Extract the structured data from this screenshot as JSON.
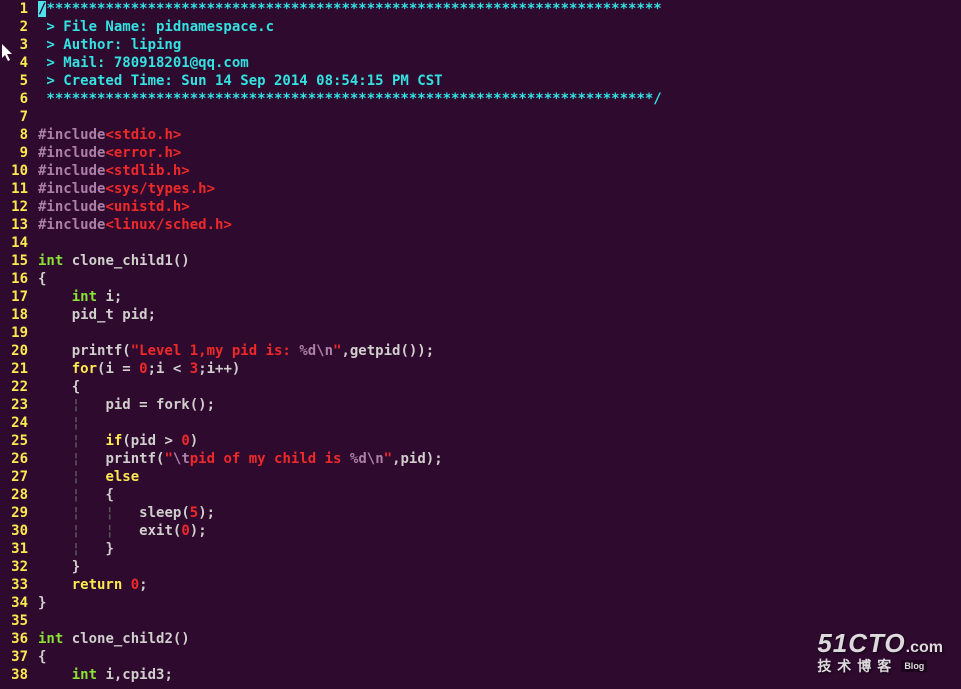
{
  "file": {
    "name": "pidnamespace.c",
    "author": "liping",
    "email": "780918201@qq.com",
    "created": "Sun 14 Sep 2014 08:54:15 PM CST"
  },
  "watermark": {
    "site_main": "51CTO",
    "site_domain": ".com",
    "subtitle": "技术博客",
    "badge": "Blog"
  },
  "lines": [
    {
      "n": 1,
      "segs": [
        {
          "cls": "cursor-cell",
          "t": "/"
        },
        {
          "cls": "c-comment",
          "t": "*************************************************************************"
        }
      ]
    },
    {
      "n": 2,
      "segs": [
        {
          "cls": "c-comment",
          "t": " > File Name: pidnamespace.c"
        }
      ]
    },
    {
      "n": 3,
      "segs": [
        {
          "cls": "c-comment",
          "t": " > Author: liping"
        }
      ]
    },
    {
      "n": 4,
      "segs": [
        {
          "cls": "c-comment",
          "t": " > Mail: 780918201@qq.com"
        }
      ]
    },
    {
      "n": 5,
      "segs": [
        {
          "cls": "c-comment",
          "t": " > Created Time: Sun 14 Sep 2014 08:54:15 PM CST"
        }
      ]
    },
    {
      "n": 6,
      "segs": [
        {
          "cls": "c-comment",
          "t": " ************************************************************************/"
        }
      ]
    },
    {
      "n": 7,
      "segs": [
        {
          "cls": "",
          "t": ""
        }
      ]
    },
    {
      "n": 8,
      "segs": [
        {
          "cls": "c-pp",
          "t": "#include"
        },
        {
          "cls": "c-hdr",
          "t": "<stdio.h>"
        }
      ]
    },
    {
      "n": 9,
      "segs": [
        {
          "cls": "c-pp",
          "t": "#include"
        },
        {
          "cls": "c-hdr",
          "t": "<error.h>"
        }
      ]
    },
    {
      "n": 10,
      "segs": [
        {
          "cls": "c-pp",
          "t": "#include"
        },
        {
          "cls": "c-hdr",
          "t": "<stdlib.h>"
        }
      ]
    },
    {
      "n": 11,
      "segs": [
        {
          "cls": "c-pp",
          "t": "#include"
        },
        {
          "cls": "c-hdr",
          "t": "<sys/types.h>"
        }
      ]
    },
    {
      "n": 12,
      "segs": [
        {
          "cls": "c-pp",
          "t": "#include"
        },
        {
          "cls": "c-hdr",
          "t": "<unistd.h>"
        }
      ]
    },
    {
      "n": 13,
      "segs": [
        {
          "cls": "c-pp",
          "t": "#include"
        },
        {
          "cls": "c-hdr",
          "t": "<linux/sched.h>"
        }
      ]
    },
    {
      "n": 14,
      "segs": [
        {
          "cls": "",
          "t": ""
        }
      ]
    },
    {
      "n": 15,
      "segs": [
        {
          "cls": "c-type",
          "t": "int"
        },
        {
          "cls": "",
          "t": " clone_child1()"
        }
      ]
    },
    {
      "n": 16,
      "segs": [
        {
          "cls": "",
          "t": "{"
        }
      ]
    },
    {
      "n": 17,
      "segs": [
        {
          "cls": "",
          "t": "    "
        },
        {
          "cls": "c-type",
          "t": "int"
        },
        {
          "cls": "",
          "t": " i;"
        }
      ]
    },
    {
      "n": 18,
      "segs": [
        {
          "cls": "",
          "t": "    pid_t pid;"
        }
      ]
    },
    {
      "n": 19,
      "segs": [
        {
          "cls": "",
          "t": ""
        }
      ]
    },
    {
      "n": 20,
      "segs": [
        {
          "cls": "",
          "t": "    printf("
        },
        {
          "cls": "c-str",
          "t": "\"Level 1,my pid is: "
        },
        {
          "cls": "c-fmt",
          "t": "%d\\n"
        },
        {
          "cls": "c-str",
          "t": "\""
        },
        {
          "cls": "",
          "t": ",getpid());"
        }
      ]
    },
    {
      "n": 21,
      "segs": [
        {
          "cls": "",
          "t": "    "
        },
        {
          "cls": "c-kw",
          "t": "for"
        },
        {
          "cls": "",
          "t": "(i = "
        },
        {
          "cls": "c-num",
          "t": "0"
        },
        {
          "cls": "",
          "t": ";i < "
        },
        {
          "cls": "c-num",
          "t": "3"
        },
        {
          "cls": "",
          "t": ";i++)"
        }
      ]
    },
    {
      "n": 22,
      "segs": [
        {
          "cls": "",
          "t": "    {"
        }
      ]
    },
    {
      "n": 23,
      "segs": [
        {
          "cls": "",
          "t": "    "
        },
        {
          "cls": "c-guide",
          "t": "¦"
        },
        {
          "cls": "",
          "t": "   pid = fork();"
        }
      ]
    },
    {
      "n": 24,
      "segs": [
        {
          "cls": "",
          "t": "    "
        },
        {
          "cls": "c-guide",
          "t": "¦"
        },
        {
          "cls": "",
          "t": ""
        }
      ]
    },
    {
      "n": 25,
      "segs": [
        {
          "cls": "",
          "t": "    "
        },
        {
          "cls": "c-guide",
          "t": "¦"
        },
        {
          "cls": "",
          "t": "   "
        },
        {
          "cls": "c-kw",
          "t": "if"
        },
        {
          "cls": "",
          "t": "(pid > "
        },
        {
          "cls": "c-num",
          "t": "0"
        },
        {
          "cls": "",
          "t": ")"
        }
      ]
    },
    {
      "n": 26,
      "segs": [
        {
          "cls": "",
          "t": "    "
        },
        {
          "cls": "c-guide",
          "t": "¦"
        },
        {
          "cls": "",
          "t": "   printf("
        },
        {
          "cls": "c-str",
          "t": "\""
        },
        {
          "cls": "c-fmt",
          "t": "\\t"
        },
        {
          "cls": "c-str",
          "t": "pid of my child is "
        },
        {
          "cls": "c-fmt",
          "t": "%d\\n"
        },
        {
          "cls": "c-str",
          "t": "\""
        },
        {
          "cls": "",
          "t": ",pid);"
        }
      ]
    },
    {
      "n": 27,
      "segs": [
        {
          "cls": "",
          "t": "    "
        },
        {
          "cls": "c-guide",
          "t": "¦"
        },
        {
          "cls": "",
          "t": "   "
        },
        {
          "cls": "c-kw",
          "t": "else"
        }
      ]
    },
    {
      "n": 28,
      "segs": [
        {
          "cls": "",
          "t": "    "
        },
        {
          "cls": "c-guide",
          "t": "¦"
        },
        {
          "cls": "",
          "t": "   {"
        }
      ]
    },
    {
      "n": 29,
      "segs": [
        {
          "cls": "",
          "t": "    "
        },
        {
          "cls": "c-guide",
          "t": "¦"
        },
        {
          "cls": "",
          "t": "   "
        },
        {
          "cls": "c-guide",
          "t": "¦"
        },
        {
          "cls": "",
          "t": "   sleep("
        },
        {
          "cls": "c-num",
          "t": "5"
        },
        {
          "cls": "",
          "t": ");"
        }
      ]
    },
    {
      "n": 30,
      "segs": [
        {
          "cls": "",
          "t": "    "
        },
        {
          "cls": "c-guide",
          "t": "¦"
        },
        {
          "cls": "",
          "t": "   "
        },
        {
          "cls": "c-guide",
          "t": "¦"
        },
        {
          "cls": "",
          "t": "   exit("
        },
        {
          "cls": "c-num",
          "t": "0"
        },
        {
          "cls": "",
          "t": ");"
        }
      ]
    },
    {
      "n": 31,
      "segs": [
        {
          "cls": "",
          "t": "    "
        },
        {
          "cls": "c-guide",
          "t": "¦"
        },
        {
          "cls": "",
          "t": "   }"
        }
      ]
    },
    {
      "n": 32,
      "segs": [
        {
          "cls": "",
          "t": "    }"
        }
      ]
    },
    {
      "n": 33,
      "segs": [
        {
          "cls": "",
          "t": "    "
        },
        {
          "cls": "c-kw",
          "t": "return"
        },
        {
          "cls": "",
          "t": " "
        },
        {
          "cls": "c-num",
          "t": "0"
        },
        {
          "cls": "",
          "t": ";"
        }
      ]
    },
    {
      "n": 34,
      "segs": [
        {
          "cls": "",
          "t": "}"
        }
      ]
    },
    {
      "n": 35,
      "segs": [
        {
          "cls": "",
          "t": ""
        }
      ]
    },
    {
      "n": 36,
      "segs": [
        {
          "cls": "c-type",
          "t": "int"
        },
        {
          "cls": "",
          "t": " clone_child2()"
        }
      ]
    },
    {
      "n": 37,
      "segs": [
        {
          "cls": "",
          "t": "{"
        }
      ]
    },
    {
      "n": 38,
      "segs": [
        {
          "cls": "",
          "t": "    "
        },
        {
          "cls": "c-type",
          "t": "int"
        },
        {
          "cls": "",
          "t": " i,cpid3;"
        }
      ]
    }
  ]
}
